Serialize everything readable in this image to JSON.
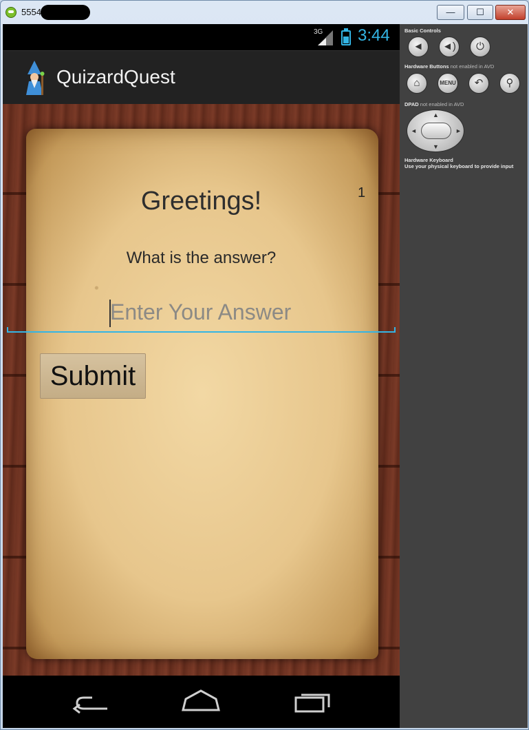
{
  "window": {
    "title": "5554",
    "buttons": {
      "minimize": "—",
      "maximize": "☐",
      "close": "✕"
    }
  },
  "statusbar": {
    "signal": "3G",
    "time": "3:44"
  },
  "actionbar": {
    "app_name": "QuizardQuest"
  },
  "quiz": {
    "greeting": "Greetings!",
    "counter": "1",
    "question": "What is the answer?",
    "answer_placeholder": "Enter Your Answer",
    "answer_value": "",
    "submit_label": "Submit"
  },
  "panel": {
    "basic_controls": "Basic Controls",
    "hardware_buttons": "Hardware Buttons",
    "hardware_buttons_note": "not enabled in AVD",
    "menu_label": "MENU",
    "dpad": "DPAD",
    "dpad_note": "not enabled in AVD",
    "keyboard_title": "Hardware Keyboard",
    "keyboard_note": "Use your physical keyboard to provide input"
  },
  "colors": {
    "accent": "#33b5e5",
    "actionbar": "#222222",
    "panel": "#414141"
  },
  "icons": [
    "emulator-app-icon",
    "signal-icon",
    "battery-icon",
    "wizard-icon",
    "volume-down-icon",
    "volume-up-icon",
    "power-icon",
    "home-icon",
    "back-icon",
    "search-icon",
    "dpad-icon",
    "nav-back-icon",
    "nav-home-icon",
    "nav-recents-icon"
  ]
}
